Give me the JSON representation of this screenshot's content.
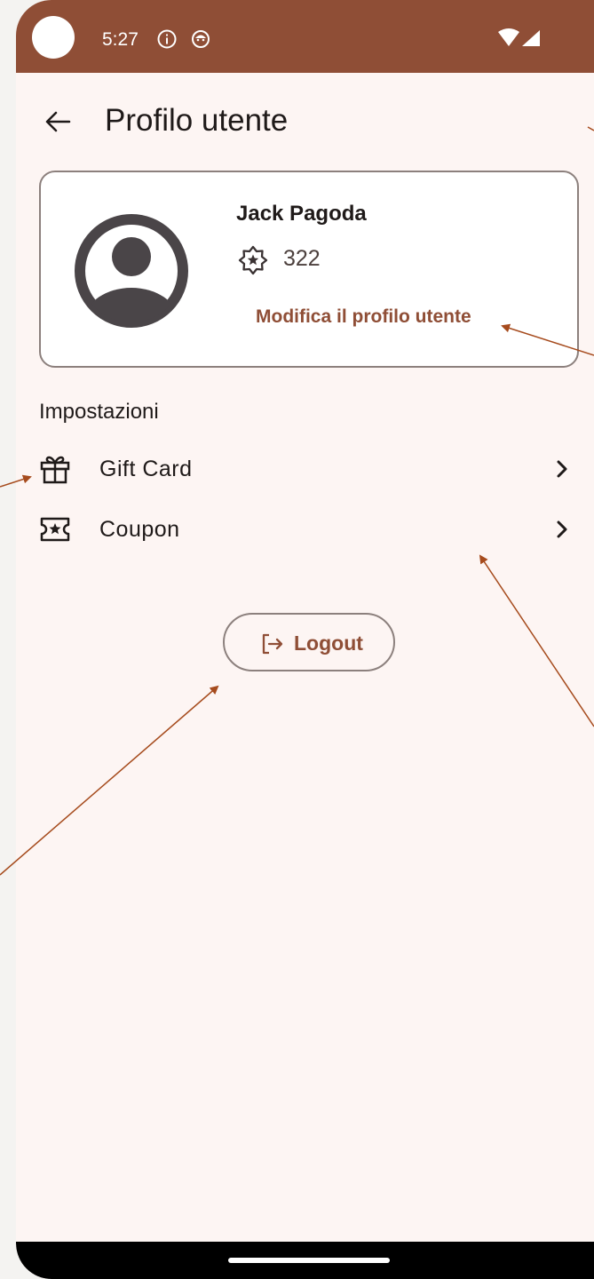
{
  "status_bar": {
    "time": "5:27"
  },
  "app_bar": {
    "title": "Profilo utente"
  },
  "profile": {
    "name": "Jack Pagoda",
    "points": "322",
    "edit_label": "Modifica il profilo utente"
  },
  "settings": {
    "title": "Impostazioni",
    "items": [
      {
        "label": "Gift Card",
        "icon": "gift-icon"
      },
      {
        "label": "Coupon",
        "icon": "coupon-icon"
      }
    ]
  },
  "logout": {
    "label": "Logout"
  },
  "colors": {
    "primary": "#8f4e36",
    "background": "#fdf5f3",
    "on_surface": "#1f1a19",
    "outline": "#8c807d",
    "annotation_arrow": "#a64b1d"
  }
}
